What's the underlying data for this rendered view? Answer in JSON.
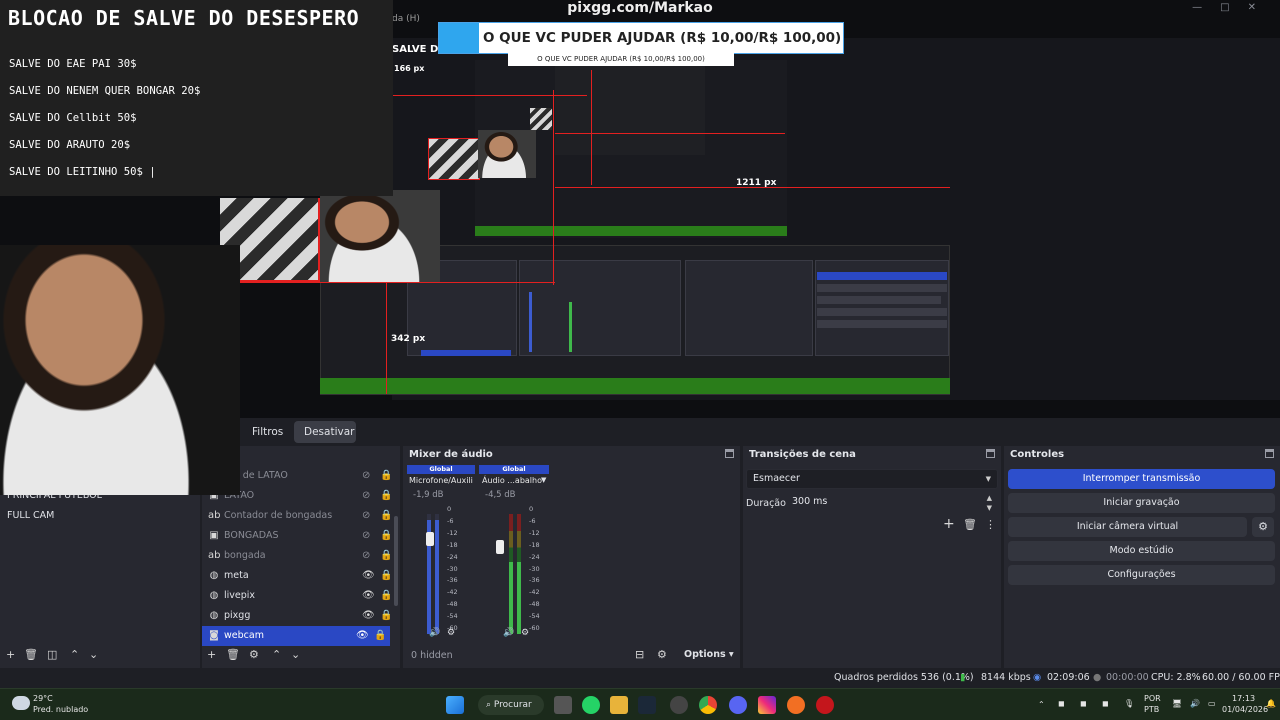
{
  "window": {
    "title": "pixgg.com/Markao"
  },
  "notepad": {
    "title": "BLOCAO DE SALVE DO DESESPERO",
    "lines": [
      "SALVE DO EAE PAI 30$",
      "SALVE DO NENEM QUER BONGAR 20$",
      "SALVE DO Cellbit 50$",
      "SALVE DO ARAUTO 20$",
      "SALVE DO LEITINHO 50$ |"
    ]
  },
  "banner": {
    "text": "O QUE VC PUDER AJUDAR (R$ 10,00/R$ 100,00)",
    "small": "O QUE VC PUDER AJUDAR (R$ 10,00/R$ 100,00)"
  },
  "preview": {
    "menu_ghost": "da (H)",
    "salve_ghost": "SALVE DO",
    "px166": "166 px",
    "px1211": "1211 px",
    "px342": "342 px"
  },
  "dock_tabs": {
    "filtros": "Filtros",
    "desativar": "Desativar"
  },
  "scenes": {
    "items": [
      "PRINCIPAL FUTEBOL",
      "FULL CAM"
    ]
  },
  "sources": {
    "items": [
      {
        "label": "dor de LATAO",
        "icon": "text",
        "visible": false
      },
      {
        "label": "LATAO",
        "icon": "image",
        "visible": false
      },
      {
        "label": "Contador de bongadas",
        "icon": "text",
        "visible": false
      },
      {
        "label": "BONGADAS",
        "icon": "image",
        "visible": false
      },
      {
        "label": "bongada",
        "icon": "text",
        "visible": false
      },
      {
        "label": "meta",
        "icon": "browser",
        "visible": true
      },
      {
        "label": "livepix",
        "icon": "browser",
        "visible": true
      },
      {
        "label": "pixgg",
        "icon": "browser",
        "visible": true
      },
      {
        "label": "webcam",
        "icon": "camera",
        "visible": true,
        "selected": true
      }
    ]
  },
  "mixer": {
    "title": "Mixer de áudio",
    "channels": [
      {
        "global": "Global",
        "name": "Microfone/Auxili",
        "db": "-1,9 dB",
        "level": 0.75
      },
      {
        "global": "Global",
        "name": "Áudio ...abalho",
        "db": "-4,5 dB",
        "level": 0.7
      }
    ],
    "scale": [
      "0",
      "-6",
      "-12",
      "-18",
      "-24",
      "-30",
      "-36",
      "-42",
      "-48",
      "-54",
      "-60"
    ],
    "hidden": "0 hidden",
    "options": "Options"
  },
  "transitions": {
    "title": "Transições de cena",
    "selected": "Esmaecer",
    "duration_label": "Duração",
    "duration_value": "300 ms"
  },
  "controls": {
    "title": "Controles",
    "stop_stream": "Interromper transmissão",
    "start_recording": "Iniciar gravação",
    "virtual_cam": "Iniciar câmera virtual",
    "studio_mode": "Modo estúdio",
    "settings": "Configurações"
  },
  "status": {
    "dropped": "Quadros perdidos 536 (0.1%)",
    "kbps": "8144 kbps",
    "stream_time": "02:09:06",
    "rec_time": "00:00:00",
    "cpu": "CPU: 2.8%",
    "fps": "60.00 / 60.00 FPS"
  },
  "taskbar": {
    "weather_temp": "29°C",
    "weather_desc": "Pred. nublado",
    "search": "Procurar",
    "lang1": "POR",
    "lang2": "PTB",
    "time": "17:13",
    "date": "01/04/2026"
  },
  "colors": {
    "accent": "#2d4fcc",
    "red_guides": "#e32020",
    "taskbar": "#1b2a1b"
  }
}
